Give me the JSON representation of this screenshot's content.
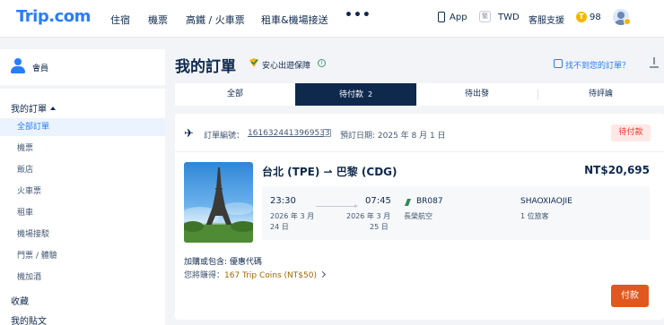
{
  "header": {
    "logo": "Trip.com",
    "nav": [
      "住宿",
      "機票",
      "高鐵 / 火車票",
      "租車&機場接送"
    ],
    "more": "•••",
    "app": "App",
    "currency_icon_text": "繁",
    "currency": "TWD",
    "support": "客服支援",
    "coins": "98"
  },
  "sidebar": {
    "member": "會員",
    "orders_heading": "我的訂單",
    "items": [
      "全部訂單",
      "機票",
      "飯店",
      "火車票",
      "租車",
      "機場接駁",
      "門票 / 體驗",
      "機加酒"
    ],
    "active_index": 0,
    "favorites": "收藏",
    "posts": "我的貼文"
  },
  "main": {
    "title": "我的訂單",
    "safe_label": "安心出遊保障",
    "find_order": "找不到您的訂單？",
    "tabs": [
      {
        "label": "全部",
        "count": ""
      },
      {
        "label": "待付款",
        "count": "2"
      },
      {
        "label": "待出發",
        "count": ""
      },
      {
        "label": "待評論",
        "count": ""
      }
    ],
    "active_tab": 1
  },
  "order": {
    "number_label": "訂單編號：",
    "number": "1616324413969533",
    "booking_date": "預訂日期: 2025 年 8 月 1 日",
    "status": "待付款",
    "route": "台北 (TPE) ⇀ 巴黎 (CDG)",
    "price": "NT$20,695",
    "depart_time": "23:30",
    "depart_month": "2026 年 3 月",
    "depart_day": "24 日",
    "arrive_time": "07:45",
    "arrive_month": "2026 年 3 月",
    "arrive_day": "25 日",
    "flight_no": "BR087",
    "airline": "長榮航空",
    "passenger_name": "SHAOXIAOJIE",
    "passenger_count": "1 位旅客",
    "addon_label": "加購或包含: 優惠代碼",
    "coins_prefix": "您將賺得：",
    "coins_value": "167 Trip Coins (NT$50)",
    "pay_button": "付款"
  },
  "colors": {
    "brand": "#287dfa",
    "navy": "#0f294d",
    "status_red": "#e83a2b",
    "pay_orange": "#e0581f",
    "airline_green": "#2e8b57"
  }
}
